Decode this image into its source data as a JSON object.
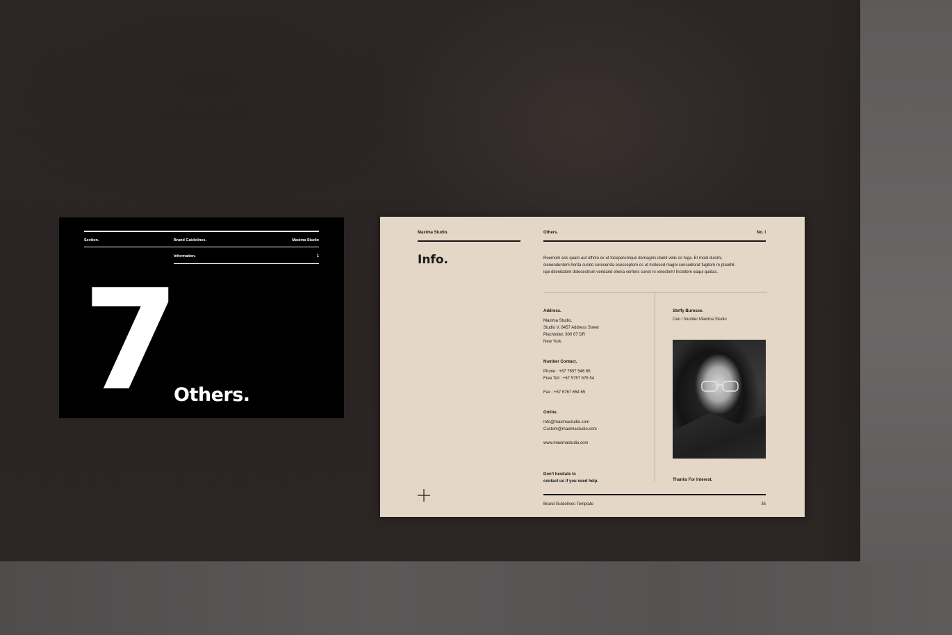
{
  "colors": {
    "black_slide_bg": "#000000",
    "beige_slide_bg": "#e4d7c7",
    "ink": "#1b1715",
    "backdrop": "#2b2524"
  },
  "black_slide": {
    "section_label": "Section.",
    "doc_label": "Brand Guidelines.",
    "studio_label": "Maxima Studio",
    "sub_label": "Information.",
    "sub_number": "1",
    "number": "7",
    "title": "Others."
  },
  "beige_slide": {
    "studio_label": "Maxima Studio.",
    "section_label": "Others.",
    "page_no": "No. I",
    "title": "Info.",
    "intro_lines": [
      "Roemom eos quam aut officto ex et foceperumque demagnis idunti velis os fuga. Et modi ducimi,",
      "sienenduntem horita sundo coresenda esecceptom os ut molesed magni consediorat fugitom re planihil-",
      "iqui ditenitatem dolecestrum vendand elenia verferis conet ro velectem! Inctotem eaqui quidas."
    ],
    "address": {
      "heading": "Address.",
      "lines": [
        "Maxima Studio.",
        "Studio V, 8457 Address Street",
        "Placholder, 800 67 DR",
        "New York."
      ]
    },
    "contact": {
      "heading": "Number Contact.",
      "phone": "Phone : +87 7657 546 65",
      "toll": "Free Toll : +67 5757 676 54",
      "fax": "Fax : +87 6767 654 65"
    },
    "online": {
      "heading": "Online.",
      "email1": "Info@maximastudio.com",
      "email2": "Custom@maximastudio.com",
      "web": "www.maximastudio.com"
    },
    "cta_lines": [
      "Don't hesitate to",
      "contact us if you need help."
    ],
    "person": {
      "name": "Steffy Burosse.",
      "role": "Ceo / founder Maxima Studio"
    },
    "thanks": "Thanks For Interest.",
    "footer_left": "Brand Guidelines Template",
    "footer_page": "35",
    "icons": {
      "plus": "plus-icon",
      "photo": "portrait-photo"
    }
  }
}
